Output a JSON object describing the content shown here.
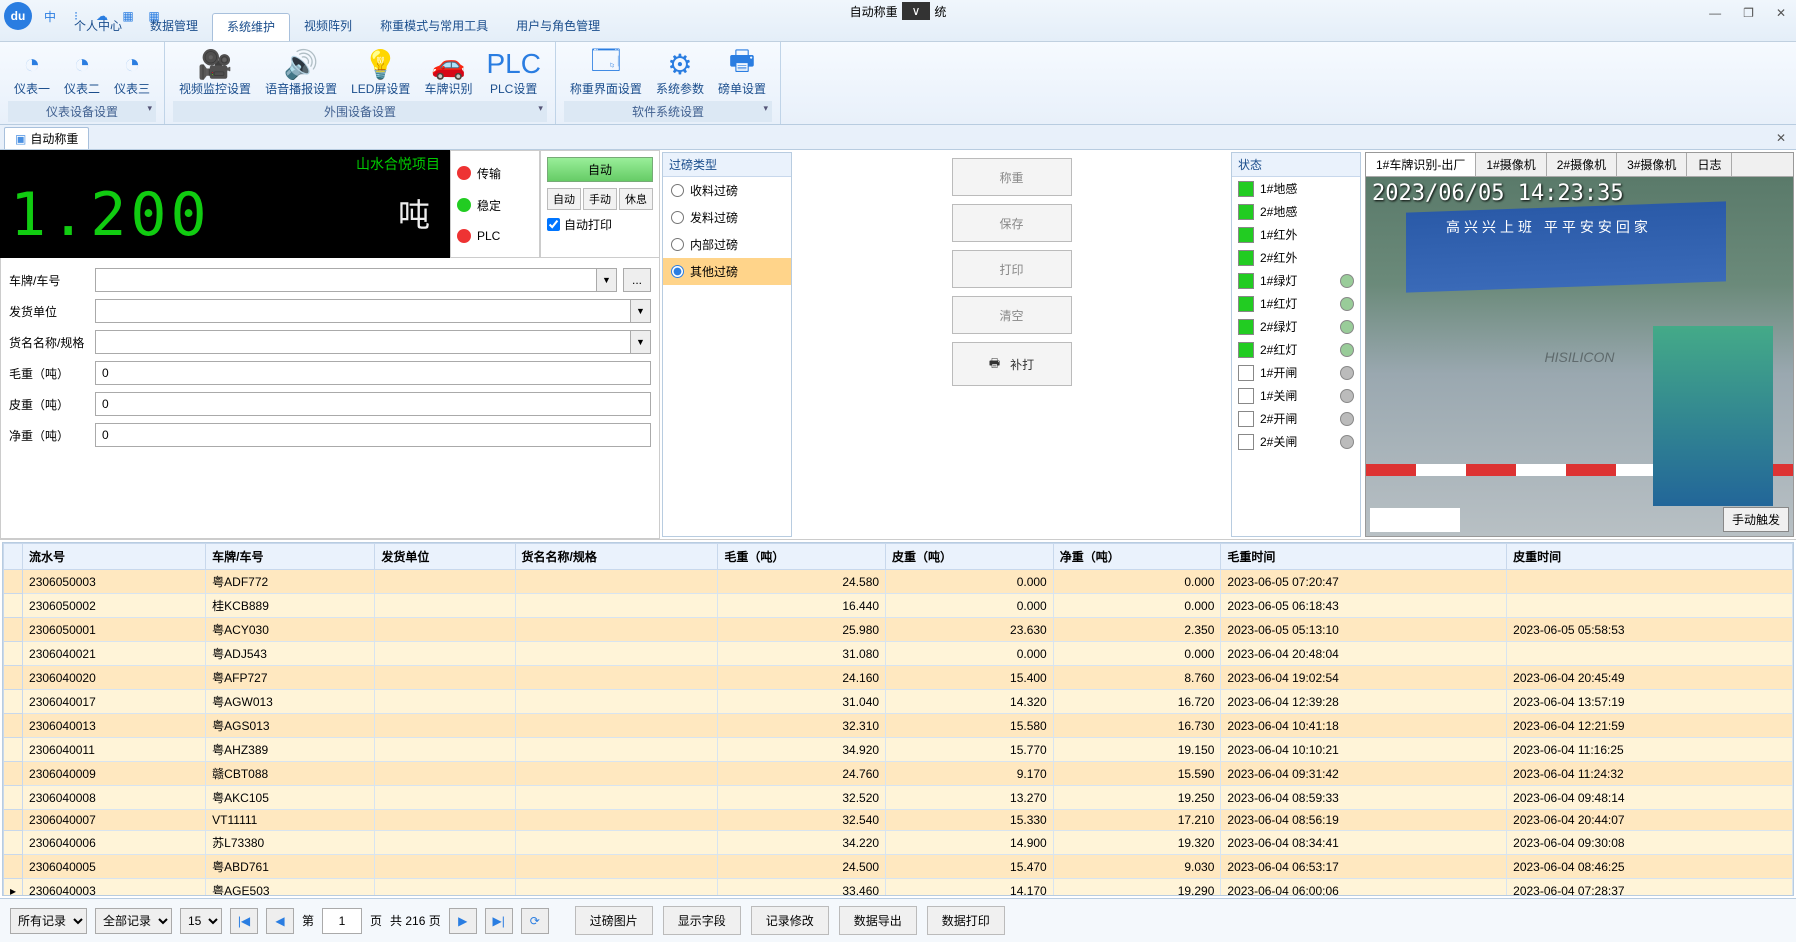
{
  "title": {
    "app_prefix": "自动称重",
    "app_suffix": "统",
    "dropdown_glyph": "∨"
  },
  "title_icons": {
    "lang": "中",
    "i2": "⁝",
    "i3": "☁",
    "i4": "▦",
    "i5": "▦"
  },
  "win": {
    "min": "—",
    "max": "❐",
    "close": "✕"
  },
  "menu": {
    "items": [
      "个人中心",
      "数据管理",
      "系统维护",
      "视频阵列",
      "称重模式与常用工具",
      "用户与角色管理"
    ],
    "active": 2
  },
  "ribbon": {
    "groups": [
      {
        "label": "仪表设备设置",
        "items": [
          {
            "name": "meter1",
            "icon": "◔",
            "label": "仪表一"
          },
          {
            "name": "meter2",
            "icon": "◔",
            "label": "仪表二"
          },
          {
            "name": "meter3",
            "icon": "◔",
            "label": "仪表三"
          }
        ]
      },
      {
        "label": "外围设备设置",
        "items": [
          {
            "name": "video-cfg",
            "icon": "🎥",
            "label": "视频监控设置"
          },
          {
            "name": "voice-cfg",
            "icon": "🔊",
            "label": "语音播报设置"
          },
          {
            "name": "led-cfg",
            "icon": "💡",
            "label": "LED屏设置"
          },
          {
            "name": "plate-cfg",
            "icon": "🚗",
            "label": "车牌识别"
          },
          {
            "name": "plc-cfg",
            "icon": "PLC",
            "label": "PLC设置"
          }
        ]
      },
      {
        "label": "软件系统设置",
        "items": [
          {
            "name": "ui-cfg",
            "icon": "🗔",
            "label": "称重界面设置"
          },
          {
            "name": "sys-param",
            "icon": "⚙",
            "label": "系统参数"
          },
          {
            "name": "ticket-cfg",
            "icon": "🖶",
            "label": "磅单设置"
          }
        ]
      }
    ]
  },
  "tab": {
    "icon": "▣",
    "label": "自动称重"
  },
  "weigh": {
    "project": "山水合悦项目",
    "value": "1.200",
    "unit": "吨",
    "status": [
      {
        "name": "transport",
        "color": "#e33",
        "label": "传输"
      },
      {
        "name": "stable",
        "color": "#2c2",
        "label": "稳定"
      },
      {
        "name": "plc",
        "color": "#e33",
        "label": "PLC"
      }
    ],
    "mode": {
      "auto": "自动",
      "buttons": [
        "自动",
        "手动",
        "休息"
      ],
      "autoprint": "自动打印",
      "autoprint_checked": true
    }
  },
  "form": {
    "rows": [
      {
        "name": "plate",
        "label": "车牌/车号",
        "type": "combo-ellip",
        "value": ""
      },
      {
        "name": "shipper",
        "label": "发货单位",
        "type": "combo",
        "value": ""
      },
      {
        "name": "goods",
        "label": "货名名称/规格",
        "type": "combo",
        "value": ""
      },
      {
        "name": "gross",
        "label": "毛重（吨）",
        "type": "text",
        "value": "0"
      },
      {
        "name": "tare",
        "label": "皮重（吨）",
        "type": "text",
        "value": "0"
      },
      {
        "name": "net",
        "label": "净重（吨）",
        "type": "text",
        "value": "0"
      }
    ]
  },
  "filter": {
    "title": "过磅类型",
    "options": [
      {
        "name": "receive",
        "label": "收料过磅",
        "sel": false
      },
      {
        "name": "send",
        "label": "发料过磅",
        "sel": false
      },
      {
        "name": "internal",
        "label": "内部过磅",
        "sel": false
      },
      {
        "name": "other",
        "label": "其他过磅",
        "sel": true
      }
    ]
  },
  "actions": {
    "weigh": "称重",
    "save": "保存",
    "print": "打印",
    "clear": "清空",
    "supplement": "补打"
  },
  "status": {
    "title": "状态",
    "items": [
      {
        "label": "1#地感",
        "on": true,
        "shape": "sq"
      },
      {
        "label": "2#地感",
        "on": true,
        "shape": "sq"
      },
      {
        "label": "1#红外",
        "on": true,
        "shape": "sq"
      },
      {
        "label": "2#红外",
        "on": true,
        "shape": "sq"
      },
      {
        "label": "1#绿灯",
        "on": true,
        "shape": "sq",
        "dot": "#9c9"
      },
      {
        "label": "1#红灯",
        "on": true,
        "shape": "sq",
        "dot": "#9c9"
      },
      {
        "label": "2#绿灯",
        "on": true,
        "shape": "sq",
        "dot": "#9c9"
      },
      {
        "label": "2#红灯",
        "on": true,
        "shape": "sq",
        "dot": "#9c9"
      },
      {
        "label": "1#开闸",
        "on": false,
        "shape": "sq",
        "dot": "#bbb"
      },
      {
        "label": "1#关闸",
        "on": false,
        "shape": "sq",
        "dot": "#bbb"
      },
      {
        "label": "2#开闸",
        "on": false,
        "shape": "sq",
        "dot": "#bbb"
      },
      {
        "label": "2#关闸",
        "on": false,
        "shape": "sq",
        "dot": "#bbb"
      }
    ]
  },
  "camera": {
    "tabs": [
      "1#车牌识别-出厂",
      "1#摄像机",
      "2#摄像机",
      "3#摄像机",
      "日志"
    ],
    "active": 0,
    "timestamp": "2023/06/05 14:23:35",
    "watermark": "HISILICON",
    "gate_text": "高兴兴上班 平平安安回家",
    "trigger": "手动触发"
  },
  "table": {
    "cols": [
      "流水号",
      "车牌/车号",
      "发货单位",
      "货名名称/规格",
      "毛重（吨）",
      "皮重（吨）",
      "净重（吨）",
      "毛重时间",
      "皮重时间"
    ],
    "rows": [
      [
        "2306050003",
        "粤ADF772",
        "",
        "",
        "24.580",
        "0.000",
        "0.000",
        "2023-06-05 07:20:47",
        ""
      ],
      [
        "2306050002",
        "桂KCB889",
        "",
        "",
        "16.440",
        "0.000",
        "0.000",
        "2023-06-05 06:18:43",
        ""
      ],
      [
        "2306050001",
        "粤ACY030",
        "",
        "",
        "25.980",
        "23.630",
        "2.350",
        "2023-06-05 05:13:10",
        "2023-06-05 05:58:53"
      ],
      [
        "2306040021",
        "粤ADJ543",
        "",
        "",
        "31.080",
        "0.000",
        "0.000",
        "2023-06-04 20:48:04",
        ""
      ],
      [
        "2306040020",
        "粤AFP727",
        "",
        "",
        "24.160",
        "15.400",
        "8.760",
        "2023-06-04 19:02:54",
        "2023-06-04 20:45:49"
      ],
      [
        "2306040017",
        "粤AGW013",
        "",
        "",
        "31.040",
        "14.320",
        "16.720",
        "2023-06-04 12:39:28",
        "2023-06-04 13:57:19"
      ],
      [
        "2306040013",
        "粤AGS013",
        "",
        "",
        "32.310",
        "15.580",
        "16.730",
        "2023-06-04 10:41:18",
        "2023-06-04 12:21:59"
      ],
      [
        "2306040011",
        "粤AHZ389",
        "",
        "",
        "34.920",
        "15.770",
        "19.150",
        "2023-06-04 10:10:21",
        "2023-06-04 11:16:25"
      ],
      [
        "2306040009",
        "赣CBT088",
        "",
        "",
        "24.760",
        "9.170",
        "15.590",
        "2023-06-04 09:31:42",
        "2023-06-04 11:24:32"
      ],
      [
        "2306040008",
        "粤AKC105",
        "",
        "",
        "32.520",
        "13.270",
        "19.250",
        "2023-06-04 08:59:33",
        "2023-06-04 09:48:14"
      ],
      [
        "2306040007",
        "VT11111",
        "",
        "",
        "32.540",
        "15.330",
        "17.210",
        "2023-06-04 08:56:19",
        "2023-06-04 20:44:07"
      ],
      [
        "2306040006",
        "苏L73380",
        "",
        "",
        "34.220",
        "14.900",
        "19.320",
        "2023-06-04 08:34:41",
        "2023-06-04 09:30:08"
      ],
      [
        "2306040005",
        "粤ABD761",
        "",
        "",
        "24.500",
        "15.470",
        "9.030",
        "2023-06-04 06:53:17",
        "2023-06-04 08:46:25"
      ],
      [
        "2306040003",
        "粤AGE503",
        "",
        "",
        "33.460",
        "14.170",
        "19.290",
        "2023-06-04 06:00:06",
        "2023-06-04 07:28:37"
      ]
    ]
  },
  "footer": {
    "filter1": "所有记录",
    "filter2": "全部记录",
    "pagesize": "15",
    "nav": {
      "first": "|◀",
      "prev": "◀",
      "label1": "第",
      "page": "1",
      "label2": "页",
      "total_label": "共 216 页",
      "next": "▶",
      "last": "▶|",
      "refresh": "⟳"
    },
    "buttons": [
      "过磅图片",
      "显示字段",
      "记录修改",
      "数据导出",
      "数据打印"
    ]
  }
}
